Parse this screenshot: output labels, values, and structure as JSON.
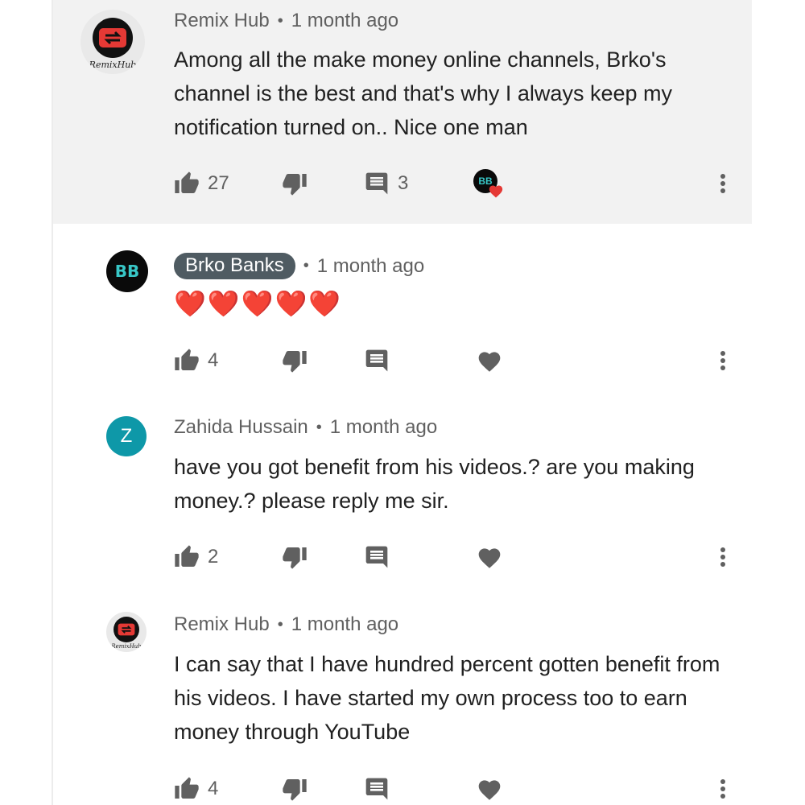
{
  "comments": [
    {
      "author": "Remix Hub",
      "time": "1 month ago",
      "text": "Among all the make money online channels, Brko's channel is the best and that's why I always keep my notification turned on.. Nice one man",
      "likes": "27",
      "replies": "3",
      "avatar_icon": "remix-hub-logo",
      "avatar_tag": "RemixHub",
      "hearted_by_creator": true,
      "highlighted": true
    },
    {
      "author": "Brko Banks",
      "time": "1 month ago",
      "text": "❤️❤️❤️❤️❤️",
      "likes": "4",
      "avatar_text": "BB",
      "is_channel_owner": true
    },
    {
      "author": "Zahida Hussain",
      "time": "1 month ago",
      "text": "have you got benefit from his videos.? are you making money.? please reply me sir.",
      "likes": "2",
      "avatar_letter": "Z"
    },
    {
      "author": "Remix Hub",
      "time": "1 month ago",
      "text": "I can say that I have hundred percent gotten benefit from his videos. I have started my own process too to earn money through YouTube",
      "likes": "4",
      "avatar_icon": "remix-hub-logo",
      "avatar_tag": "RemixHub"
    }
  ],
  "creator_heart_badge": "BB",
  "colors": {
    "highlight_bg": "#f2f2f2",
    "icon_gray": "#606060",
    "heart_red": "#e53935",
    "owner_chip": "#4f5b62",
    "z_avatar": "#0e98a8",
    "bb_text": "#38c7c7"
  }
}
